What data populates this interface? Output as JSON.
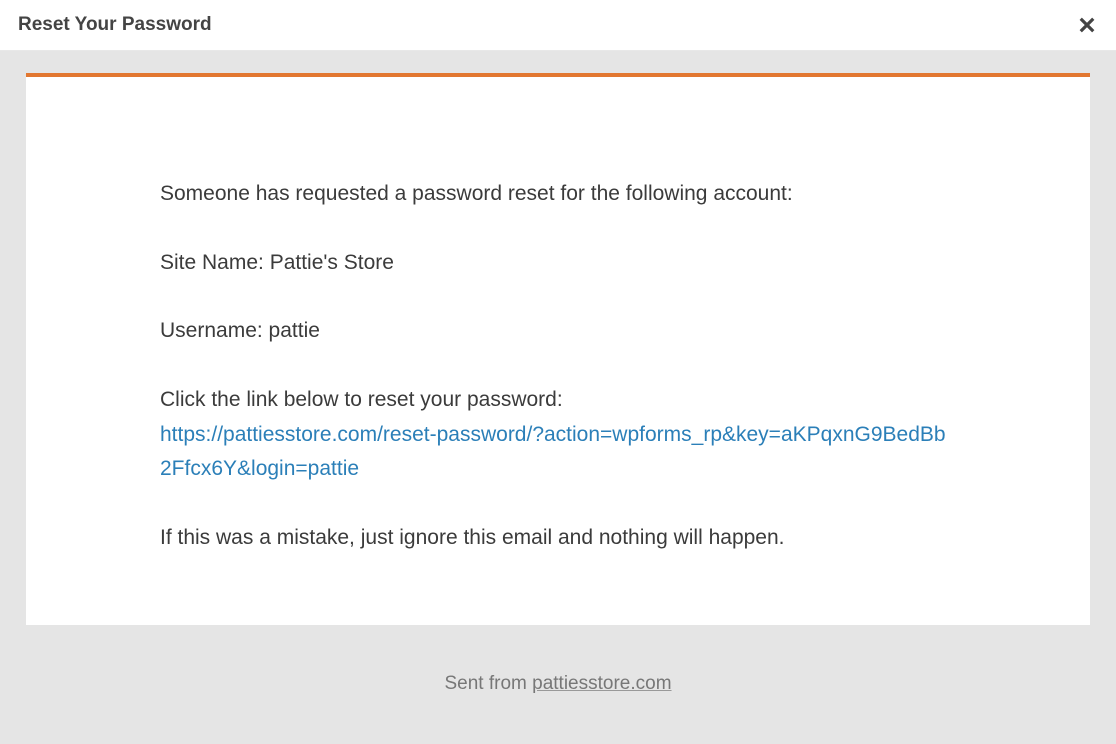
{
  "modal": {
    "title": "Reset Your Password"
  },
  "email": {
    "intro": "Someone has requested a password reset for the following account:",
    "site_name_line": "Site Name: Pattie's Store",
    "username_line": "Username: pattie",
    "instruction": "Click the link below to reset your password:",
    "reset_url": "https://pattiesstore.com/reset-password/?action=wpforms_rp&key=aKPqxnG9BedBb2Ffcx6Y&login=pattie",
    "mistake_note": "If this was a mistake, just ignore this email and nothing will happen."
  },
  "footer": {
    "sent_from_label": "Sent from ",
    "domain": "pattiesstore.com"
  },
  "colors": {
    "accent": "#e27730",
    "link": "#2b7fb8"
  }
}
